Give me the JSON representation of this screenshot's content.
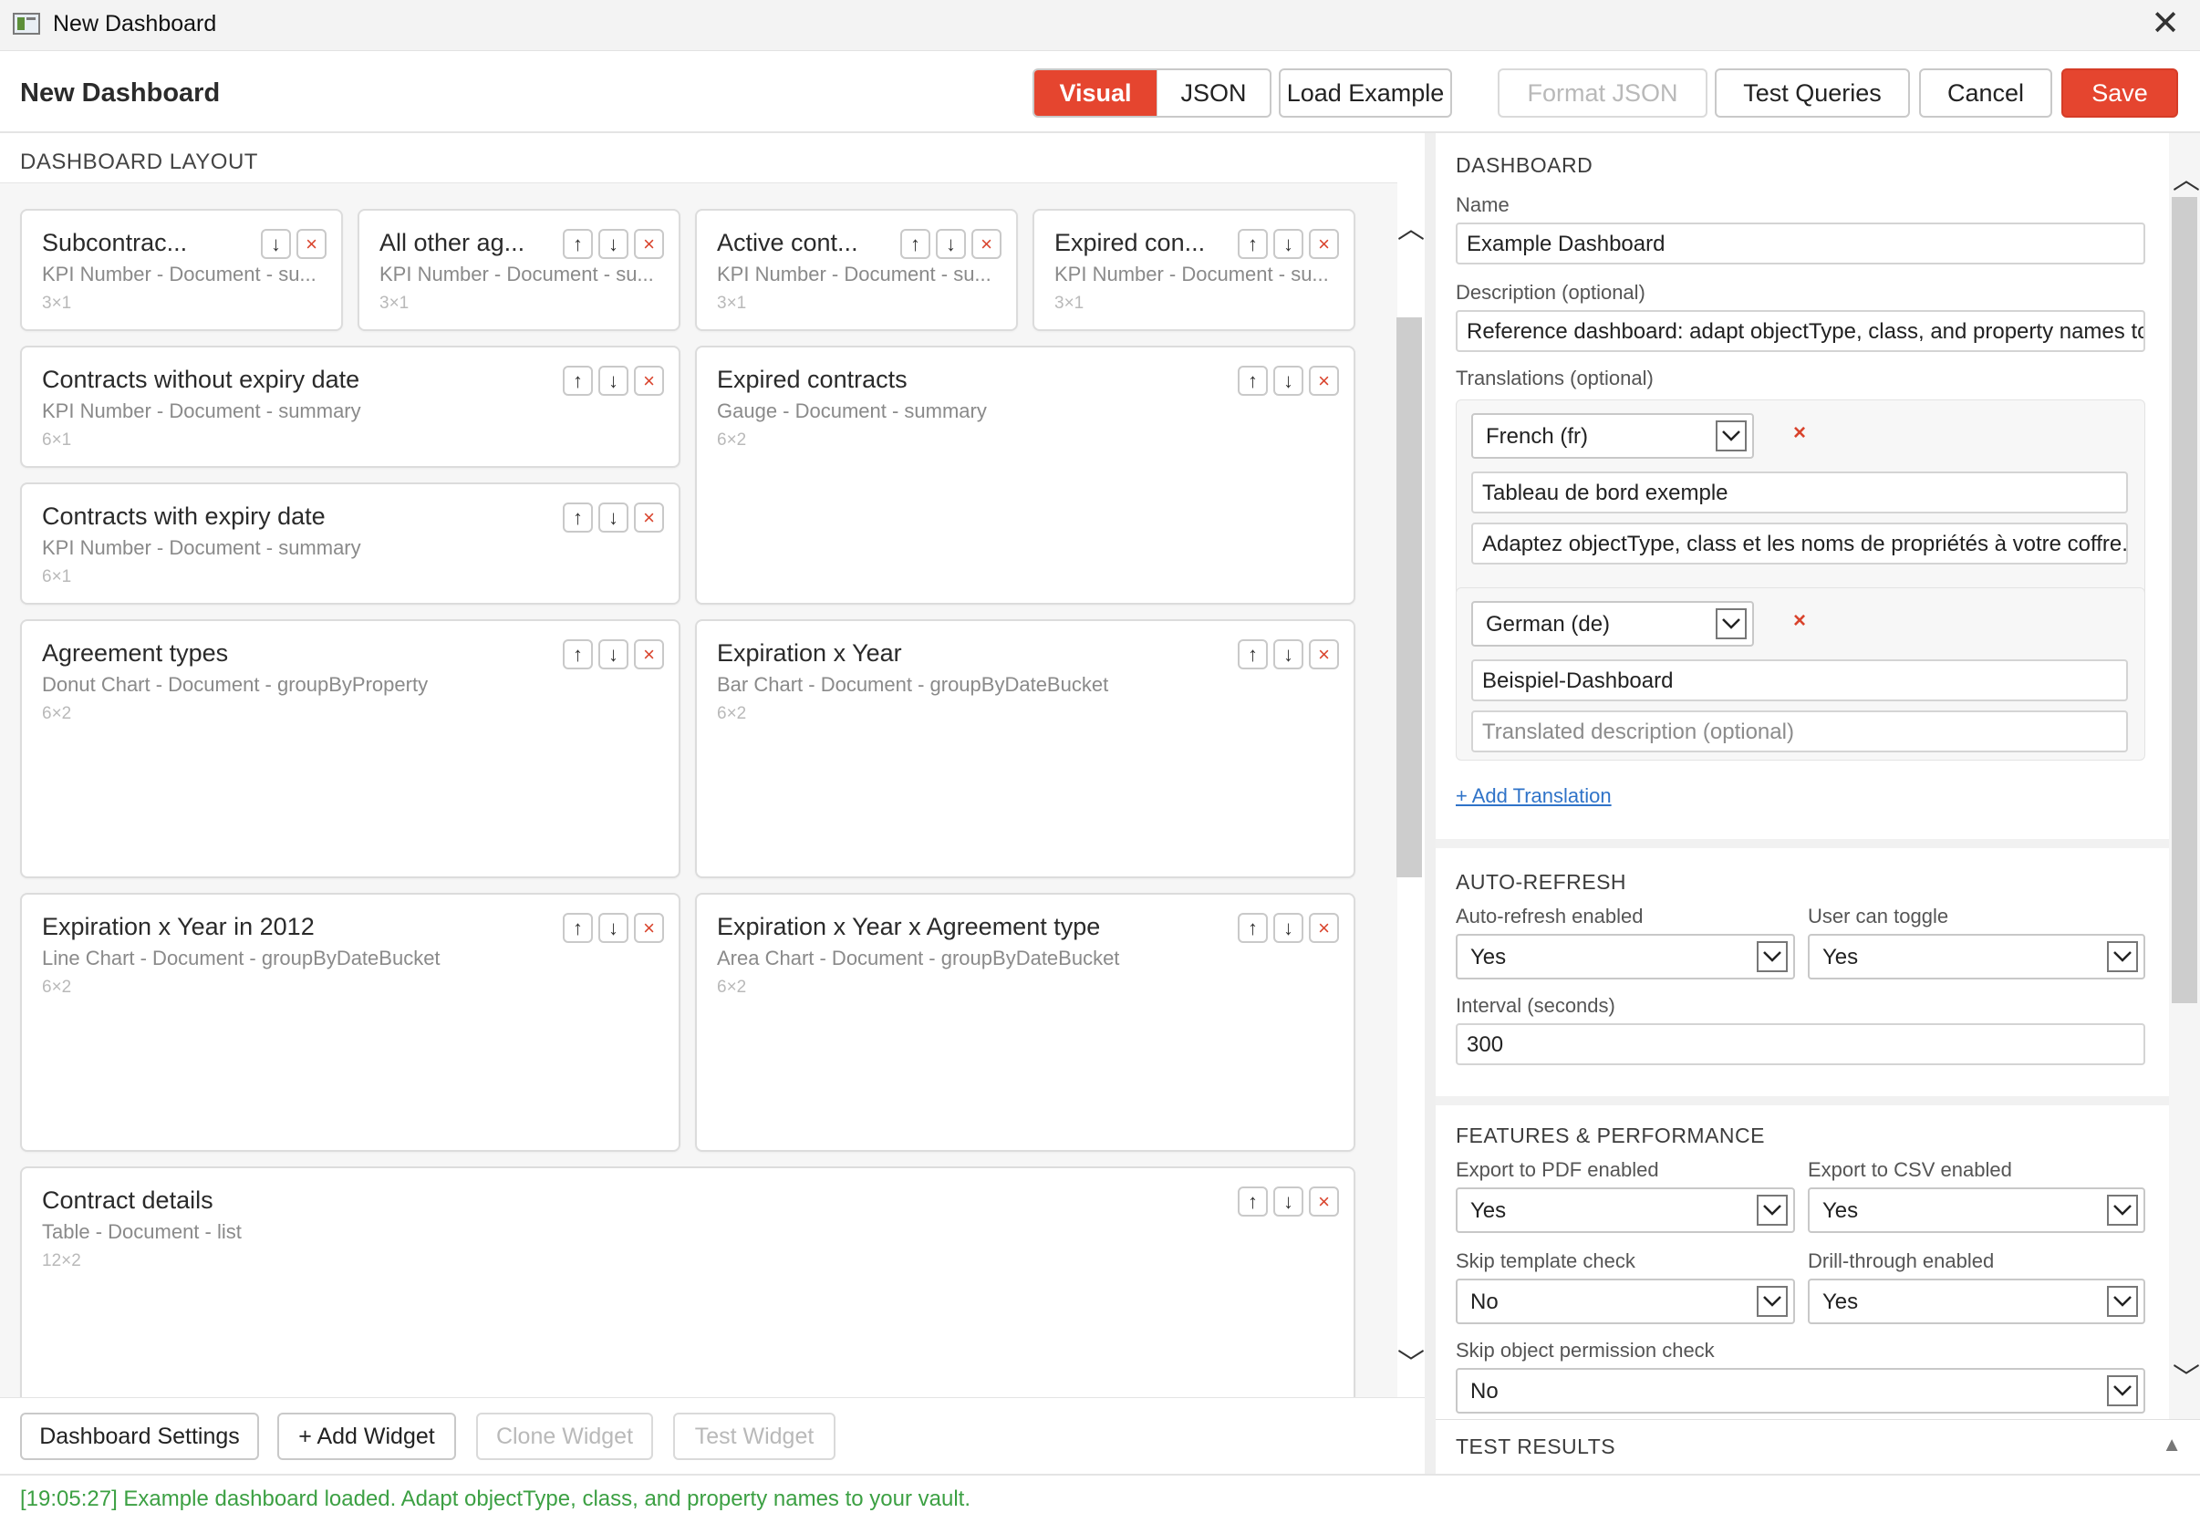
{
  "window": {
    "title": "New Dashboard",
    "close_glyph": "✕"
  },
  "header": {
    "title": "New Dashboard",
    "view_tabs": [
      {
        "label": "Visual",
        "active": true
      },
      {
        "label": "JSON",
        "active": false
      }
    ],
    "buttons": {
      "load_example": "Load Example",
      "format_json": "Format JSON",
      "test_queries": "Test Queries",
      "cancel": "Cancel",
      "save": "Save"
    },
    "accent_color": "#e5452f"
  },
  "layout": {
    "heading": "DASHBOARD LAYOUT",
    "widgets": [
      {
        "title": "Subcontrac...",
        "subtitle": "KPI Number - Document - su...",
        "size": "3×1",
        "controls": [
          "↓",
          "×"
        ]
      },
      {
        "title": "All other ag...",
        "subtitle": "KPI Number - Document - su...",
        "size": "3×1",
        "controls": [
          "↑",
          "↓",
          "×"
        ]
      },
      {
        "title": "Active cont...",
        "subtitle": "KPI Number - Document - su...",
        "size": "3×1",
        "controls": [
          "↑",
          "↓",
          "×"
        ]
      },
      {
        "title": "Expired con...",
        "subtitle": "KPI Number - Document - su...",
        "size": "3×1",
        "controls": [
          "↑",
          "↓",
          "×"
        ]
      },
      {
        "title": "Contracts without expiry date",
        "subtitle": "KPI Number - Document - summary",
        "size": "6×1",
        "controls": [
          "↑",
          "↓",
          "×"
        ]
      },
      {
        "title": "Expired contracts",
        "subtitle": "Gauge - Document - summary",
        "size": "6×2",
        "controls": [
          "↑",
          "↓",
          "×"
        ]
      },
      {
        "title": "Contracts with expiry date",
        "subtitle": "KPI Number - Document - summary",
        "size": "6×1",
        "controls": [
          "↑",
          "↓",
          "×"
        ]
      },
      {
        "title": "Agreement types",
        "subtitle": "Donut Chart - Document - groupByProperty",
        "size": "6×2",
        "controls": [
          "↑",
          "↓",
          "×"
        ]
      },
      {
        "title": "Expiration x Year",
        "subtitle": "Bar Chart - Document - groupByDateBucket",
        "size": "6×2",
        "controls": [
          "↑",
          "↓",
          "×"
        ]
      },
      {
        "title": "Expiration x Year in 2012",
        "subtitle": "Line Chart - Document - groupByDateBucket",
        "size": "6×2",
        "controls": [
          "↑",
          "↓",
          "×"
        ]
      },
      {
        "title": "Expiration x Year x Agreement type",
        "subtitle": "Area Chart - Document - groupByDateBucket",
        "size": "6×2",
        "controls": [
          "↑",
          "↓",
          "×"
        ]
      },
      {
        "title": "Contract details",
        "subtitle": "Table - Document - list",
        "size": "12×2",
        "controls": [
          "↑",
          "↓",
          "×"
        ]
      }
    ],
    "footer_buttons": {
      "dashboard_settings": "Dashboard Settings",
      "add_widget": "+ Add Widget",
      "clone_widget": "Clone Widget",
      "test_widget": "Test Widget"
    }
  },
  "dashboard": {
    "heading": "DASHBOARD",
    "name_label": "Name",
    "name_value": "Example Dashboard",
    "description_label": "Description (optional)",
    "description_value": "Reference dashboard: adapt objectType, class, and property names to",
    "translations_label": "Translations (optional)",
    "translations": [
      {
        "language": "French (fr)",
        "title": "Tableau de bord exemple",
        "description": "Adaptez objectType, class et les noms de propriétés à votre coffre.",
        "description_placeholder": ""
      },
      {
        "language": "German (de)",
        "title": "Beispiel-Dashboard",
        "description": "",
        "description_placeholder": "Translated description (optional)"
      }
    ],
    "add_translation": "+ Add Translation"
  },
  "auto_refresh": {
    "heading": "AUTO-REFRESH",
    "enabled_label": "Auto-refresh enabled",
    "enabled_value": "Yes",
    "toggle_label": "User can toggle",
    "toggle_value": "Yes",
    "interval_label": "Interval (seconds)",
    "interval_value": "300"
  },
  "features": {
    "heading": "FEATURES & PERFORMANCE",
    "pdf_label": "Export to PDF enabled",
    "pdf_value": "Yes",
    "csv_label": "Export to CSV enabled",
    "csv_value": "Yes",
    "template_label": "Skip template check",
    "template_value": "No",
    "drill_label": "Drill-through enabled",
    "drill_value": "Yes",
    "permission_label": "Skip object permission check",
    "permission_value": "No"
  },
  "test_results": {
    "heading": "TEST RESULTS"
  },
  "status": {
    "text": "[19:05:27] Example dashboard loaded. Adapt objectType, class, and property names to your vault.",
    "color": "#3ca043"
  }
}
